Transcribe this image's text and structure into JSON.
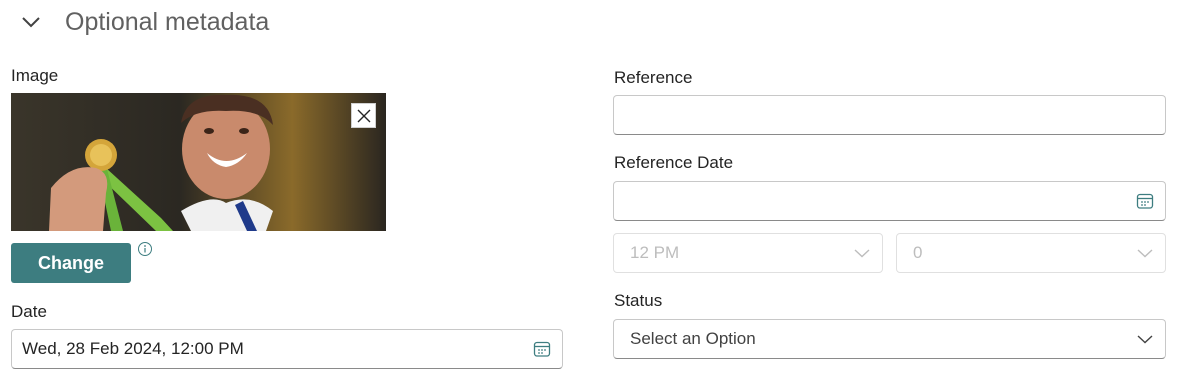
{
  "section": {
    "title": "Optional metadata"
  },
  "image": {
    "label": "Image",
    "change_label": "Change"
  },
  "date": {
    "label": "Date",
    "value": "Wed, 28 Feb 2024, 12:00 PM"
  },
  "reference": {
    "label": "Reference",
    "value": ""
  },
  "reference_date": {
    "label": "Reference Date",
    "value": "",
    "hour": "12 PM",
    "minute": "0"
  },
  "status": {
    "label": "Status",
    "placeholder": "Select an Option"
  },
  "colors": {
    "accent": "#3d7d80",
    "text": "#242424",
    "muted": "#616161",
    "disabled": "#bdbdbd"
  }
}
